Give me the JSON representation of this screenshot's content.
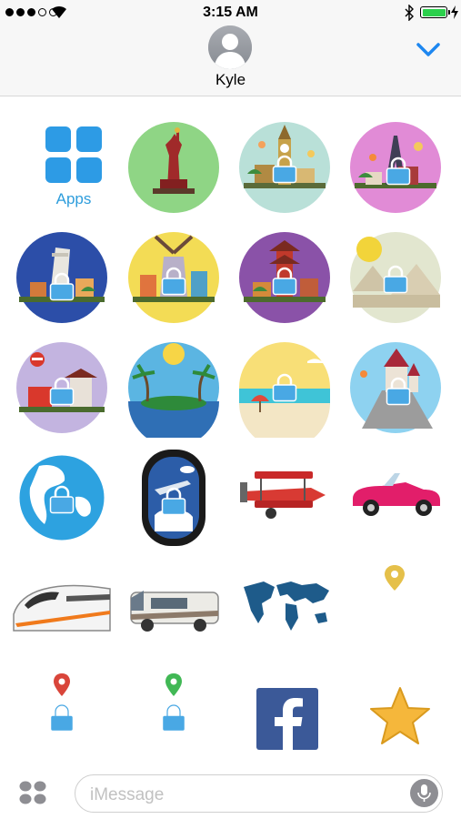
{
  "status_bar": {
    "time": "3:15 AM"
  },
  "header": {
    "contact_name": "Kyle"
  },
  "app_drawer": {
    "apps_label": "Apps"
  },
  "stickers": {
    "row1": [
      "Statue of Liberty",
      "Big Ben London",
      "Eiffel Tower Paris"
    ],
    "row2": [
      "Leaning Tower of Pisa",
      "Amsterdam Windmill",
      "Chinese Pagoda",
      "Desert Landscape"
    ],
    "row3": [
      "Tokyo",
      "Tropical Island",
      "Beach",
      "Fairytale Castle"
    ],
    "row4": [
      "Globe",
      "Airplane Window",
      "Red Biplane",
      "Pink Convertible"
    ],
    "row5": [
      "Bullet Train",
      "RV Motorhome",
      "World Map",
      "Yellow Location Pin"
    ],
    "row6": [
      "Red Pin",
      "Green Pin",
      "Facebook",
      "Star"
    ]
  },
  "input": {
    "placeholder": "iMessage"
  },
  "colors": {
    "accent": "#2e9ddc",
    "lock": "#49a8e4",
    "facebook": "#3b5998",
    "star": "#f5b73b"
  }
}
